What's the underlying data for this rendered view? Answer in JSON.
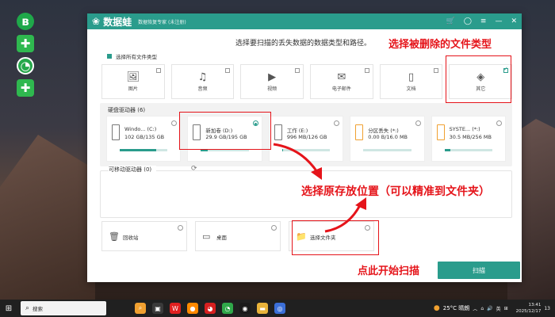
{
  "window": {
    "app_title": "数据蛙",
    "app_subtitle": "数据恢复专家 (未注册)",
    "prompt": "选择要扫描的丢失数据的数据类型和路径。",
    "select_all_label": "选择所有文件类型",
    "file_types": [
      {
        "label": "图片",
        "icon": "image-icon",
        "checked": false
      },
      {
        "label": "音频",
        "icon": "audio-icon",
        "checked": false
      },
      {
        "label": "视频",
        "icon": "video-icon",
        "checked": false
      },
      {
        "label": "电子邮件",
        "icon": "email-icon",
        "checked": false
      },
      {
        "label": "文档",
        "icon": "document-icon",
        "checked": false
      },
      {
        "label": "其它",
        "icon": "other-icon",
        "checked": true
      }
    ],
    "hdd_section_title": "硬盘驱动器 (6)",
    "drives": [
      {
        "name": "Windo... (C:)",
        "size": "102 GB/135 GB",
        "fill": 0.76,
        "selected": false,
        "color": "gray"
      },
      {
        "name": "新加卷 (D:)",
        "size": "29.9 GB/195 GB",
        "fill": 0.15,
        "selected": true,
        "color": "gray"
      },
      {
        "name": "工作 (E:)",
        "size": "996 MB/126 GB",
        "fill": 0.01,
        "selected": false,
        "color": "gray"
      },
      {
        "name": "分区丢失 (*:)",
        "size": "0.00  B/16.0 MB",
        "fill": 0.0,
        "selected": false,
        "color": "orange"
      },
      {
        "name": "SYSTE... (*:)",
        "size": "30.5 MB/256 MB",
        "fill": 0.12,
        "selected": false,
        "color": "orange"
      }
    ],
    "removable_section_title": "可移动驱动器 (0)",
    "locations": [
      {
        "label": "回收站",
        "icon": "recycle-bin-icon"
      },
      {
        "label": "桌面",
        "icon": "desktop-icon"
      },
      {
        "label": "选择文件夹",
        "icon": "folder-icon"
      }
    ],
    "scan_button": "扫描"
  },
  "annotations": {
    "file_type": "选择被删除的文件类型",
    "location": "选择原存放位置（可以精准到文件夹）",
    "scan": "点此开始扫描"
  },
  "taskbar": {
    "search_placeholder": "搜索",
    "weather": "25°C 晴朗",
    "ime": "英",
    "time": "13:41",
    "date": "2025/12/17",
    "notifications": "13"
  },
  "colors": {
    "accent": "#2a9c8c",
    "annotation_red": "#e5141a"
  }
}
